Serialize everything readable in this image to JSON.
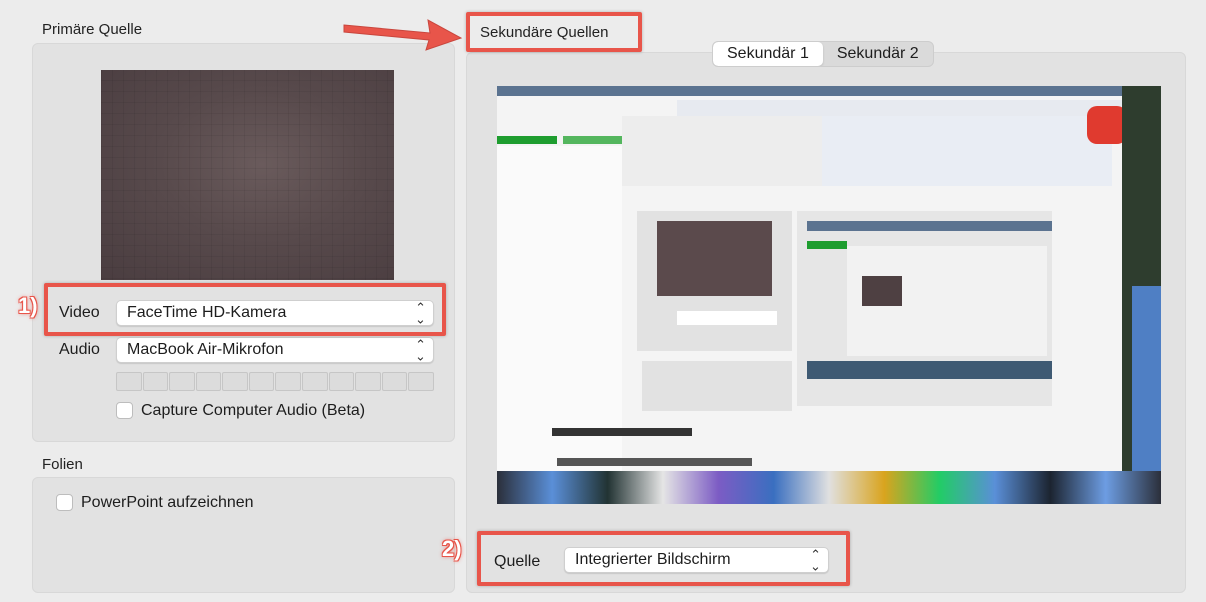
{
  "primary": {
    "title": "Primäre Quelle",
    "video_label": "Video",
    "video_value": "FaceTime HD-Kamera",
    "audio_label": "Audio",
    "audio_value": "MacBook Air-Mikrofon",
    "capture_audio_label": "Capture Computer Audio (Beta)",
    "capture_audio_checked": false
  },
  "slides": {
    "title": "Folien",
    "powerpoint_label": "PowerPoint aufzeichnen",
    "powerpoint_checked": false
  },
  "secondary": {
    "title": "Sekundäre Quellen",
    "tabs": [
      {
        "label": "Sekundär 1",
        "active": true
      },
      {
        "label": "Sekundär 2",
        "active": false
      }
    ],
    "source_label": "Quelle",
    "source_value": "Integrierter Bildschirm"
  },
  "annotations": {
    "marker_1": "1)",
    "marker_2": "2)",
    "highlight_color": "#e8554a"
  },
  "icons": [
    "up-down-chevron-icon",
    "arrow-pointer-icon"
  ]
}
